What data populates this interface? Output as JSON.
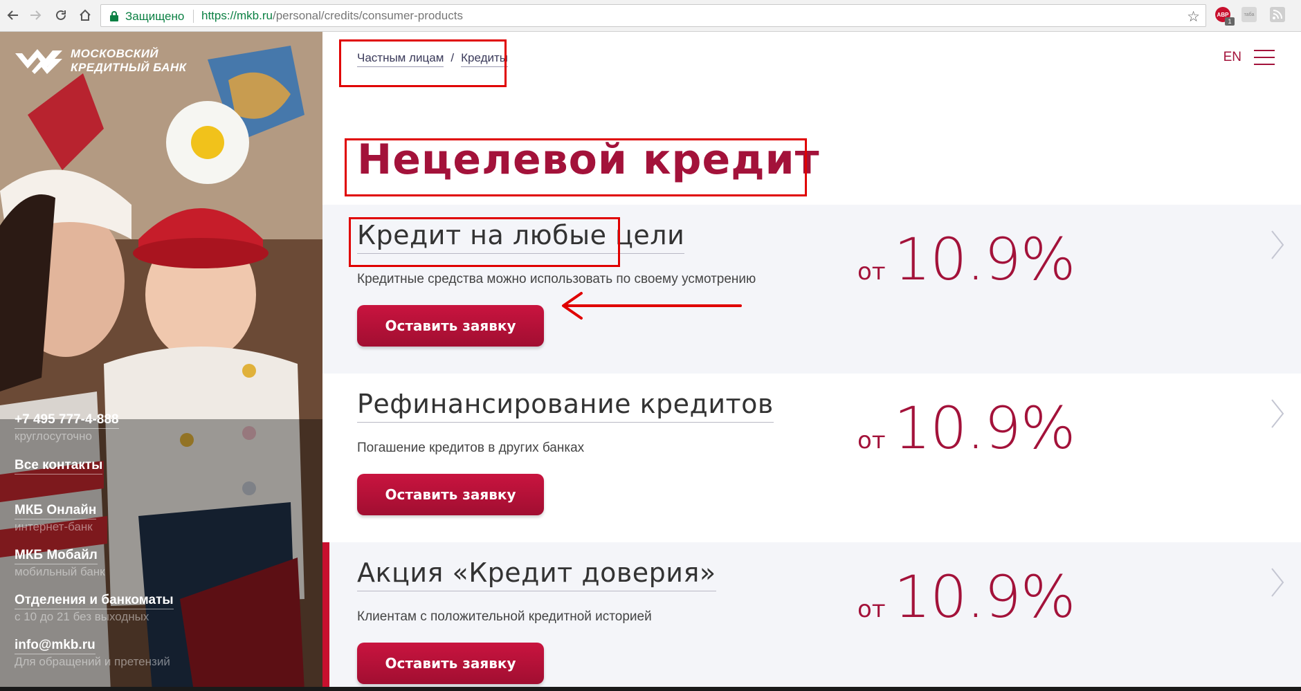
{
  "browser": {
    "secure_label": "Защищено",
    "url_host": "https://mkb.ru",
    "url_path": "/personal/credits/consumer-products",
    "ext_abp_label": "ABP",
    "ext_abp_badge": "1",
    "ext_tab_label": "таба"
  },
  "sidebar": {
    "logo_line1": "Московский",
    "logo_line2": "кредитный банк",
    "contacts": [
      {
        "main": "+7 495 777-4-888",
        "sub": "круглосуточно"
      },
      {
        "main": "Все контакты",
        "sub": ""
      },
      {
        "main": "МКБ Онлайн",
        "sub": "интернет-банк"
      },
      {
        "main": "МКБ Мобайл",
        "sub": "мобильный банк"
      },
      {
        "main": "Отделения и банкоматы",
        "sub": "с 10 до 21 без выходных"
      },
      {
        "main": "info@mkb.ru",
        "sub": "Для обращений и претензий"
      }
    ]
  },
  "header": {
    "breadcrumb": [
      {
        "label": "Частным лицам"
      },
      {
        "label": "Кредиты"
      }
    ],
    "breadcrumb_sep": "/",
    "lang": "EN"
  },
  "page": {
    "title": "Нецелевой кредит"
  },
  "products": [
    {
      "title": "Кредит на любые цели",
      "description": "Кредитные средства можно использовать по своему усмотрению",
      "rate_prefix": "от",
      "rate_value": "10.9%",
      "button": "Оставить заявку"
    },
    {
      "title": "Рефинансирование кредитов",
      "description": "Погашение кредитов в других банках",
      "rate_prefix": "от",
      "rate_value": "10.9%",
      "button": "Оставить заявку"
    },
    {
      "title": "Акция «Кредит доверия»",
      "description": "Клиентам с положительной кредитной историей",
      "rate_prefix": "от",
      "rate_value": "10.9%",
      "button": "Оставить заявку"
    }
  ],
  "colors": {
    "brand": "#a3123a",
    "button": "#b8103a",
    "annotation": "#e00000",
    "card_shade": "#f4f5f9"
  },
  "icons": {
    "back": "arrow-left-icon",
    "forward": "arrow-right-icon",
    "reload": "reload-icon",
    "home": "home-icon",
    "lock": "lock-icon",
    "bookmark": "star-icon",
    "menu": "hamburger-icon",
    "next": "chevron-right-icon"
  }
}
